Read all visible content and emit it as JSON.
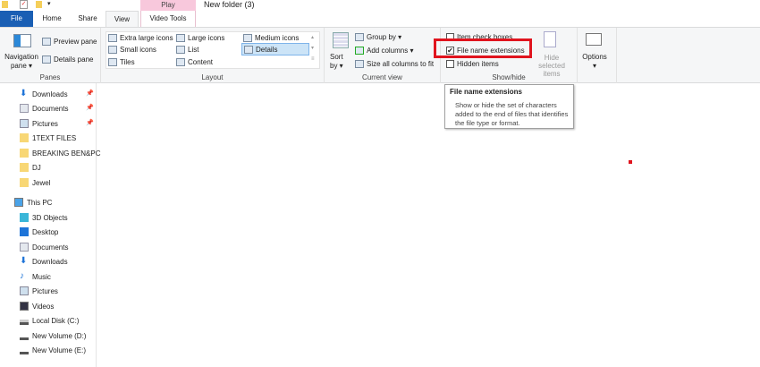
{
  "title": {
    "window_title": "New folder (3)",
    "context_tab": "Play"
  },
  "tabs": {
    "file": "File",
    "home": "Home",
    "share": "Share",
    "view": "View",
    "video_tools": "Video Tools"
  },
  "ribbon": {
    "panes": {
      "label": "Panes",
      "navigation_pane": "Navigation",
      "navigation_pane2": "pane ▾",
      "preview_pane": "Preview pane",
      "details_pane": "Details pane"
    },
    "layout": {
      "label": "Layout",
      "items": [
        "Extra large icons",
        "Large icons",
        "Medium icons",
        "Small icons",
        "List",
        "Details",
        "Tiles",
        "Content"
      ],
      "selected": "Details"
    },
    "current_view": {
      "label": "Current view",
      "sort_by": "Sort",
      "sort_by2": "by ▾",
      "group_by": "Group by ▾",
      "add_columns": "Add columns ▾",
      "size_columns": "Size all columns to fit"
    },
    "show_hide": {
      "label": "Show/hide",
      "item_check_boxes": "Item check boxes",
      "file_name_extensions": "File name extensions",
      "hidden_items": "Hidden items",
      "hide_selected": "Hide selected",
      "hide_selected2": "items",
      "checked": {
        "item_check_boxes": false,
        "file_name_extensions": true,
        "hidden_items": false
      }
    },
    "options": {
      "label": "Options",
      "arrow": "▾"
    }
  },
  "tooltip": {
    "title": "File name extensions",
    "description": "Show or hide the set of characters added to the end of files that identifies the file type or format."
  },
  "sidebar": {
    "quick_access": [
      {
        "label": "Downloads",
        "pinned": true
      },
      {
        "label": "Documents",
        "pinned": true
      },
      {
        "label": "Pictures",
        "pinned": true
      },
      {
        "label": "1TEXT FILES"
      },
      {
        "label": "BREAKING BEN&PC"
      },
      {
        "label": "DJ"
      },
      {
        "label": "Jewel"
      }
    ],
    "this_pc": "This PC",
    "pc_items": [
      "3D Objects",
      "Desktop",
      "Documents",
      "Downloads",
      "Music",
      "Pictures",
      "Videos",
      "Local Disk (C:)",
      "New Volume (D:)",
      "New Volume (E:)"
    ]
  },
  "colors": {
    "accent": "#1a5fb4",
    "highlight": "#e0141e",
    "context_tab": "#f8c8dc"
  }
}
